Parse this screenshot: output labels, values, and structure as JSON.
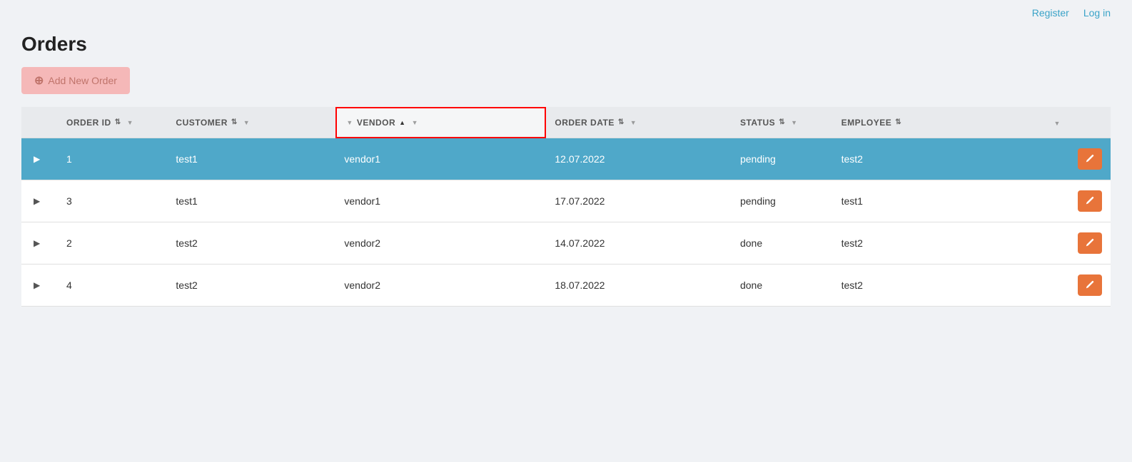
{
  "nav": {
    "register_label": "Register",
    "login_label": "Log in"
  },
  "page": {
    "title": "Orders",
    "add_button_label": "Add New Order"
  },
  "table": {
    "columns": [
      {
        "id": "expand",
        "label": ""
      },
      {
        "id": "order_id",
        "label": "ORDER ID",
        "sort": "default",
        "filter": true
      },
      {
        "id": "customer",
        "label": "CUSTOMER",
        "sort": "default",
        "filter": true
      },
      {
        "id": "vendor",
        "label": "VENDOR",
        "sort": "asc",
        "filter": true,
        "highlighted": true
      },
      {
        "id": "order_date",
        "label": "ORDER DATE",
        "sort": "default",
        "filter": true
      },
      {
        "id": "status",
        "label": "STATUS",
        "sort": "default",
        "filter": true
      },
      {
        "id": "employee",
        "label": "EMPLOYEE",
        "sort": "default",
        "filter": true
      },
      {
        "id": "action",
        "label": "",
        "filter": true
      }
    ],
    "rows": [
      {
        "id": 1,
        "order_id": "1",
        "customer": "test1",
        "vendor": "vendor1",
        "order_date": "12.07.2022",
        "status": "pending",
        "employee": "test2",
        "selected": true
      },
      {
        "id": 2,
        "order_id": "3",
        "customer": "test1",
        "vendor": "vendor1",
        "order_date": "17.07.2022",
        "status": "pending",
        "employee": "test1",
        "selected": false
      },
      {
        "id": 3,
        "order_id": "2",
        "customer": "test2",
        "vendor": "vendor2",
        "order_date": "14.07.2022",
        "status": "done",
        "employee": "test2",
        "selected": false
      },
      {
        "id": 4,
        "order_id": "4",
        "customer": "test2",
        "vendor": "vendor2",
        "order_date": "18.07.2022",
        "status": "done",
        "employee": "test2",
        "selected": false
      }
    ]
  }
}
